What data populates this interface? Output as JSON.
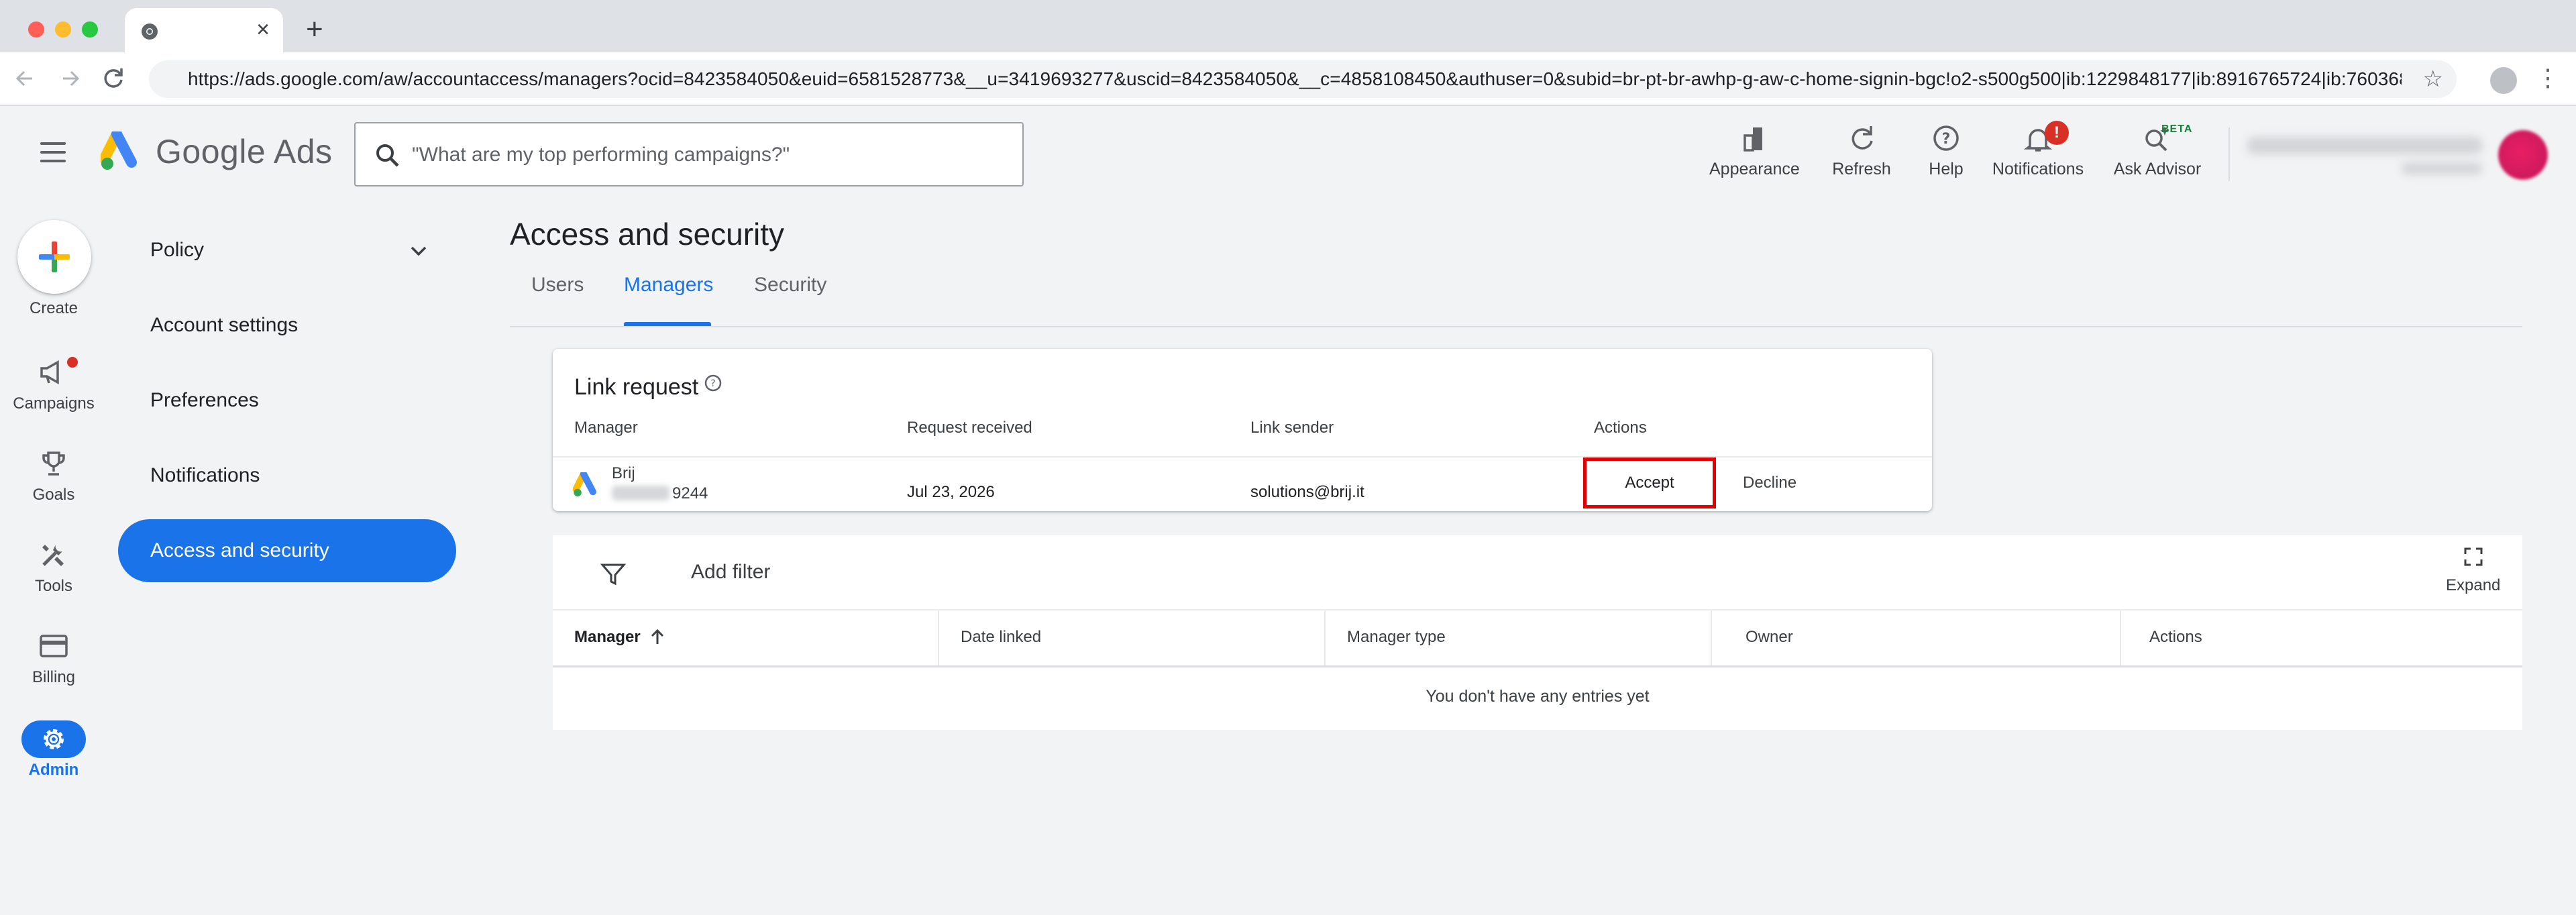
{
  "browser": {
    "tab_title": "",
    "url": "https://ads.google.com/aw/accountaccess/managers?ocid=8423584050&euid=6581528773&__u=3419693277&uscid=8423584050&__c=4858108450&authuser=0&subid=br-pt-br-awhp-g-aw-c-home-signin-bgc!o2-s500g500|ib:1229848177|ib:8916765724|ib:7603683271..."
  },
  "app": {
    "brand_google": "Google",
    "brand_ads": "Ads",
    "search_placeholder": "\"What are my top performing campaigns?\""
  },
  "header_actions": [
    {
      "label": "Appearance",
      "icon": "appearance-icon"
    },
    {
      "label": "Refresh",
      "icon": "refresh-icon"
    },
    {
      "label": "Help",
      "icon": "help-icon"
    },
    {
      "label": "Notifications",
      "icon": "bell-icon",
      "badge": "!"
    },
    {
      "label": "Ask Advisor",
      "icon": "advisor-icon",
      "tag": "BETA"
    }
  ],
  "rail": {
    "create_label": "Create",
    "items": [
      {
        "label": "Campaigns",
        "icon": "campaigns-icon"
      },
      {
        "label": "Goals",
        "icon": "trophy-icon"
      },
      {
        "label": "Tools",
        "icon": "tools-icon"
      },
      {
        "label": "Billing",
        "icon": "billing-icon"
      },
      {
        "label": "Admin",
        "icon": "gear-icon",
        "active": true
      }
    ]
  },
  "sidenav": {
    "items": [
      {
        "label": "Policy",
        "expandable": true
      },
      {
        "label": "Account settings"
      },
      {
        "label": "Preferences"
      },
      {
        "label": "Notifications"
      },
      {
        "label": "Access and security",
        "active": true
      }
    ]
  },
  "main": {
    "title": "Access and security",
    "tabs": [
      {
        "label": "Users"
      },
      {
        "label": "Managers",
        "active": true
      },
      {
        "label": "Security"
      }
    ]
  },
  "link_request": {
    "title": "Link request",
    "headers": [
      "Manager",
      "Request received",
      "Link sender",
      "Actions"
    ],
    "row": {
      "manager_name": "Brij",
      "manager_id_suffix": "9244",
      "received": "Jul 23, 2026",
      "sender": "solutions@brij.it",
      "accept_label": "Accept",
      "decline_label": "Decline"
    }
  },
  "managers_table": {
    "add_filter_label": "Add filter",
    "expand_label": "Expand",
    "headers": [
      "Manager",
      "Date linked",
      "Manager type",
      "Owner",
      "Actions"
    ],
    "empty_message": "You don't have any entries yet"
  },
  "colors": {
    "accent": "#1a73e8",
    "highlight_border": "#e00000",
    "badge": "#d93025"
  }
}
